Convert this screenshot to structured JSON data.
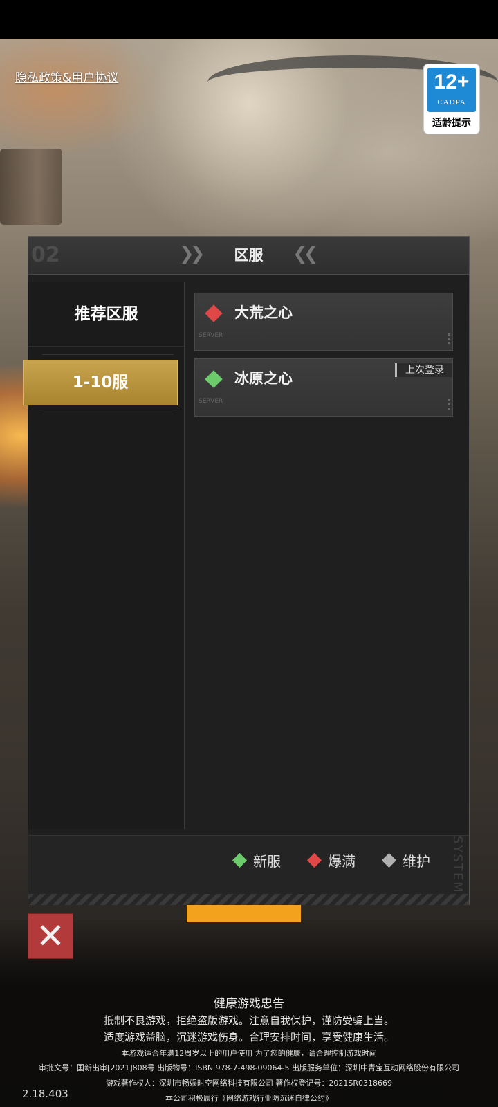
{
  "links": {
    "privacy": "隐私政策&用户协议"
  },
  "age_badge": {
    "number": "12+",
    "org": "CADPA",
    "tip": "适龄提示",
    "color": "#1e8ad6"
  },
  "dialog": {
    "title": "区服",
    "tabs": [
      {
        "label": "推荐区服",
        "active": false
      },
      {
        "label": "1-10服",
        "active": true
      }
    ],
    "servers": [
      {
        "name": "大荒之心",
        "status": "爆满",
        "status_color": "#e04848",
        "tag": ""
      },
      {
        "name": "冰原之心",
        "status": "新服",
        "status_color": "#6ccc6c",
        "tag": "上次登录"
      }
    ],
    "legend": [
      {
        "label": "新服",
        "color": "#6ccc6c"
      },
      {
        "label": "爆满",
        "color": "#e04848"
      },
      {
        "label": "维护",
        "color": "#b0b0b0"
      }
    ]
  },
  "footer": {
    "title": "健康游戏忠告",
    "line1": "抵制不良游戏，拒绝盗版游戏。注意自我保护，谨防受骗上当。",
    "line2": "适度游戏益脑，沉迷游戏伤身。合理安排时间，享受健康生活。",
    "line3": "本游戏适合年满12周岁以上的用户使用 为了您的健康，请合理控制游戏时间",
    "line4": "审批文号：国新出审[2021]808号 出版物号：ISBN 978-7-498-09064-5 出版服务单位：深圳中青宝互动网络股份有限公司",
    "line5": "游戏著作权人：深圳市畅娱时空网络科技有限公司 著作权登记号：2021SR0318669",
    "line6": "本公司积极履行《网络游戏行业防沉迷自律公约》"
  },
  "version": "2.18.403"
}
